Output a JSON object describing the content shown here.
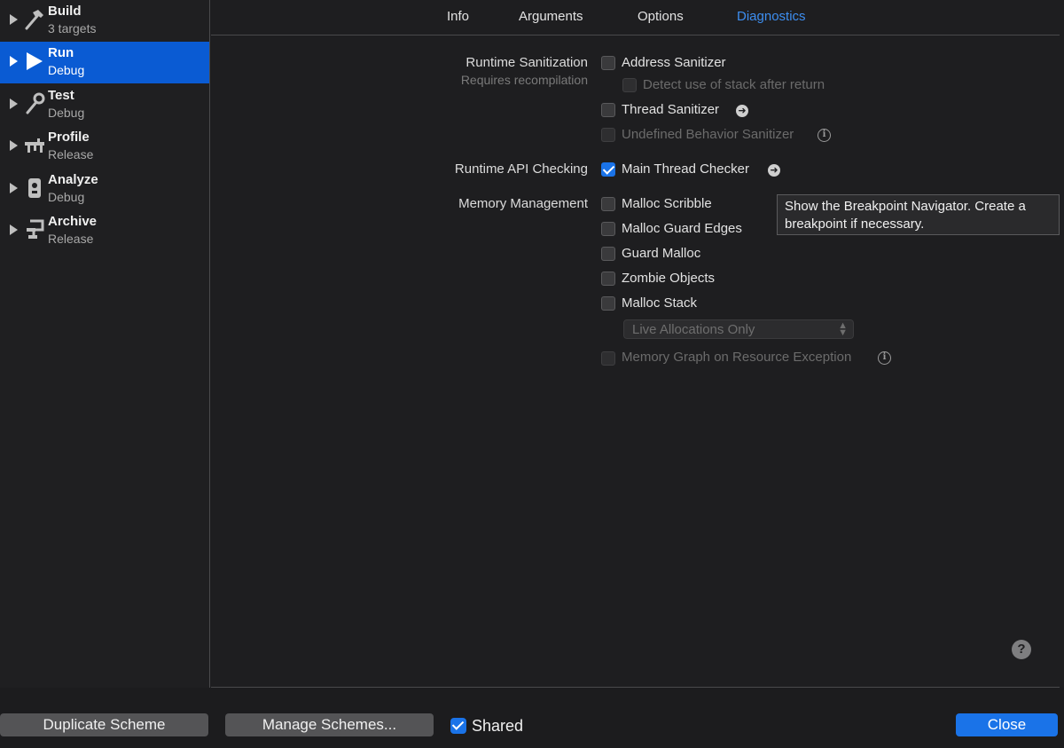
{
  "sidebar": {
    "items": [
      {
        "title": "Build",
        "subtitle": "3 targets",
        "icon": "hammer-icon"
      },
      {
        "title": "Run",
        "subtitle": "Debug",
        "icon": "play-icon",
        "selected": true
      },
      {
        "title": "Test",
        "subtitle": "Debug",
        "icon": "wrench-icon"
      },
      {
        "title": "Profile",
        "subtitle": "Release",
        "icon": "gauge-icon"
      },
      {
        "title": "Analyze",
        "subtitle": "Debug",
        "icon": "analyze-icon"
      },
      {
        "title": "Archive",
        "subtitle": "Release",
        "icon": "archive-icon"
      }
    ]
  },
  "tabs": [
    "Info",
    "Arguments",
    "Options",
    "Diagnostics"
  ],
  "active_tab": "Diagnostics",
  "sections": {
    "runtime_sanitization": {
      "label": "Runtime Sanitization",
      "sublabel": "Requires recompilation",
      "address_sanitizer": "Address Sanitizer",
      "detect_stack": "Detect use of stack after return",
      "thread_sanitizer": "Thread Sanitizer",
      "undefined_behavior": "Undefined Behavior Sanitizer"
    },
    "runtime_api": {
      "label": "Runtime API Checking",
      "main_thread_checker": "Main Thread Checker"
    },
    "memory": {
      "label": "Memory Management",
      "malloc_scribble": "Malloc Scribble",
      "malloc_guard_edges": "Malloc Guard Edges",
      "guard_malloc": "Guard Malloc",
      "zombie_objects": "Zombie Objects",
      "malloc_stack": "Malloc Stack",
      "allocations_select": "Live Allocations Only",
      "memory_graph": "Memory Graph on Resource Exception"
    }
  },
  "tooltip": "Show the Breakpoint Navigator. Create a breakpoint if necessary.",
  "help": "?",
  "footer": {
    "duplicate": "Duplicate Scheme",
    "manage": "Manage Schemes...",
    "shared": "Shared",
    "close": "Close"
  },
  "colors": {
    "accent": "#1a73e8",
    "selection": "#0a5bd3",
    "active_tab": "#3d8ef0"
  }
}
